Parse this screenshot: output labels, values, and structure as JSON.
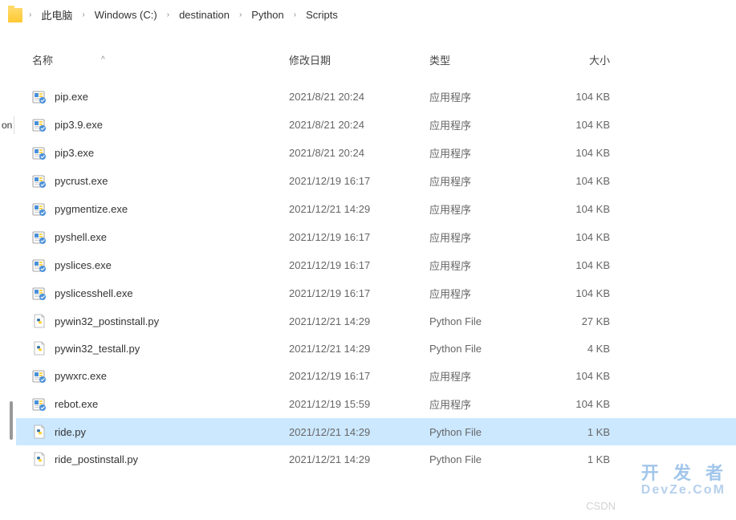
{
  "breadcrumb": {
    "items": [
      "此电脑",
      "Windows (C:)",
      "destination",
      "Python",
      "Scripts"
    ]
  },
  "columns": {
    "name": "名称",
    "date": "修改日期",
    "type": "类型",
    "size": "大小",
    "sort": "^"
  },
  "sidebar": {
    "truncated": "on"
  },
  "files": [
    {
      "name": "pip.exe",
      "date": "2021/8/21 20:24",
      "type": "应用程序",
      "size": "104 KB",
      "icon": "exe",
      "selected": false
    },
    {
      "name": "pip3.9.exe",
      "date": "2021/8/21 20:24",
      "type": "应用程序",
      "size": "104 KB",
      "icon": "exe",
      "selected": false
    },
    {
      "name": "pip3.exe",
      "date": "2021/8/21 20:24",
      "type": "应用程序",
      "size": "104 KB",
      "icon": "exe",
      "selected": false
    },
    {
      "name": "pycrust.exe",
      "date": "2021/12/19 16:17",
      "type": "应用程序",
      "size": "104 KB",
      "icon": "exe",
      "selected": false
    },
    {
      "name": "pygmentize.exe",
      "date": "2021/12/21 14:29",
      "type": "应用程序",
      "size": "104 KB",
      "icon": "exe",
      "selected": false
    },
    {
      "name": "pyshell.exe",
      "date": "2021/12/19 16:17",
      "type": "应用程序",
      "size": "104 KB",
      "icon": "exe",
      "selected": false
    },
    {
      "name": "pyslices.exe",
      "date": "2021/12/19 16:17",
      "type": "应用程序",
      "size": "104 KB",
      "icon": "exe",
      "selected": false
    },
    {
      "name": "pyslicesshell.exe",
      "date": "2021/12/19 16:17",
      "type": "应用程序",
      "size": "104 KB",
      "icon": "exe",
      "selected": false
    },
    {
      "name": "pywin32_postinstall.py",
      "date": "2021/12/21 14:29",
      "type": "Python File",
      "size": "27 KB",
      "icon": "py",
      "selected": false
    },
    {
      "name": "pywin32_testall.py",
      "date": "2021/12/21 14:29",
      "type": "Python File",
      "size": "4 KB",
      "icon": "py",
      "selected": false
    },
    {
      "name": "pywxrc.exe",
      "date": "2021/12/19 16:17",
      "type": "应用程序",
      "size": "104 KB",
      "icon": "exe",
      "selected": false
    },
    {
      "name": "rebot.exe",
      "date": "2021/12/19 15:59",
      "type": "应用程序",
      "size": "104 KB",
      "icon": "exe",
      "selected": false
    },
    {
      "name": "ride.py",
      "date": "2021/12/21 14:29",
      "type": "Python File",
      "size": "1 KB",
      "icon": "py",
      "selected": true
    },
    {
      "name": "ride_postinstall.py",
      "date": "2021/12/21 14:29",
      "type": "Python File",
      "size": "1 KB",
      "icon": "py",
      "selected": false
    }
  ],
  "watermark": {
    "main": "开 发 者",
    "sub": "DevZe.CoM",
    "csdn": "CSDN"
  }
}
